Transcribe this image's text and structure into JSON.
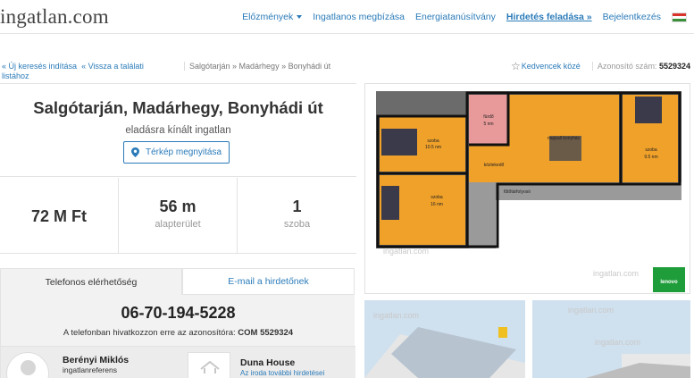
{
  "header": {
    "logo_text": "ingatlan.com",
    "nav": [
      {
        "label": "Előzmények",
        "dropdown": true
      },
      {
        "label": "Ingatlanos megbízása"
      },
      {
        "label": "Energiatanúsítvány"
      },
      {
        "label": "Hirdetés feladása »",
        "active": true
      },
      {
        "label": "Bejelentkezés"
      }
    ]
  },
  "breadcrumbs": {
    "new_search": "« Új keresés indítása",
    "back_results": "« Vissza a találati listához",
    "location_path": "Salgótarján » Madárhegy » Bonyhádi út",
    "favorites": "Kedvencek közé",
    "id_label": "Azonosító szám:",
    "id_value": "5529324"
  },
  "listing": {
    "title": "Salgótarján, Madárhegy, Bonyhádi út",
    "subtitle": "eladásra kínált ingatlan",
    "map_button": "Térkép megnyitása",
    "price": "72 M Ft",
    "area_value": "56 m",
    "area_label": "alapterület",
    "rooms_value": "1",
    "rooms_label": "szoba"
  },
  "contact": {
    "tab_phone": "Telefonos elérhetőség",
    "tab_email": "E-mail a hirdetőnek",
    "phone": "06-70-194-5228",
    "ref_text": "A telefonban hivatkozzon erre az azonosítóra:",
    "ref_code": "COM 5529324",
    "agent_name": "Berényi Miklós",
    "agent_role": "ingatlanreferens",
    "agency_name": "Duna House",
    "agency_link": "Az iroda további hirdetései"
  },
  "floorplan": {
    "rooms": [
      {
        "name": "szoba",
        "area": "10.5 nm"
      },
      {
        "name": "fürdő",
        "area": "5 nm"
      },
      {
        "name": "közlekedő",
        "area": ""
      },
      {
        "name": "nappali konyhás",
        "area": ""
      },
      {
        "name": "szoba",
        "area": "9.5 nm"
      },
      {
        "name": "szoba",
        "area": "16 nm"
      },
      {
        "name": "fűtőtárfolyosó",
        "area": ""
      }
    ],
    "badge_text": "lenovo"
  },
  "colors": {
    "accent": "#2b7bb9",
    "room_orange": "#f0a12a",
    "bath_pink": "#e89a9a",
    "badge_green": "#1f9d3a"
  }
}
